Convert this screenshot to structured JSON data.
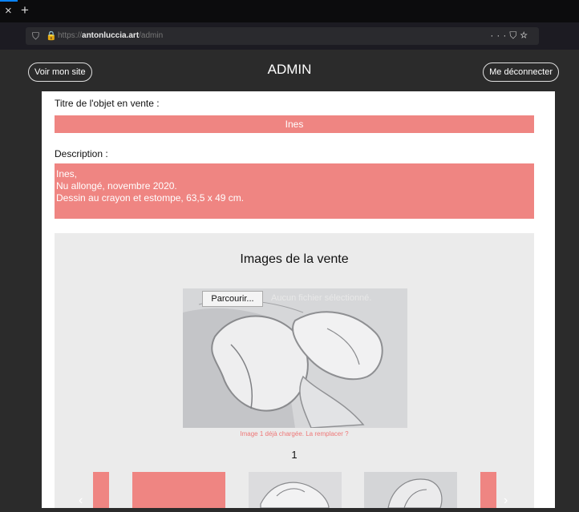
{
  "browser": {
    "url_scheme": "https://",
    "url_host": "antonluccia.art",
    "url_path": "/admin"
  },
  "header": {
    "left_button": "Voir mon site",
    "title": "ADMIN",
    "right_button": "Me déconnecter"
  },
  "form": {
    "title_label": "Titre de l'objet en vente :",
    "title_value": "Ines",
    "description_label": "Description :",
    "description_lines": [
      "Ines,",
      "Nu allongé, novembre 2020.",
      "Dessin au crayon et estompe, 63,5 x 49 cm."
    ]
  },
  "gallery": {
    "heading": "Images de la vente",
    "browse_button": "Parcourir...",
    "no_file_text": "Aucun fichier sélectionné.",
    "loaded_text": "Image 1 déjà chargée. La remplacer ?",
    "image_number": "1"
  },
  "colors": {
    "accent": "#ef8582",
    "panel": "#ffffff",
    "gallery_bg": "#ebebeb",
    "page_bg": "#2b2b2b"
  }
}
